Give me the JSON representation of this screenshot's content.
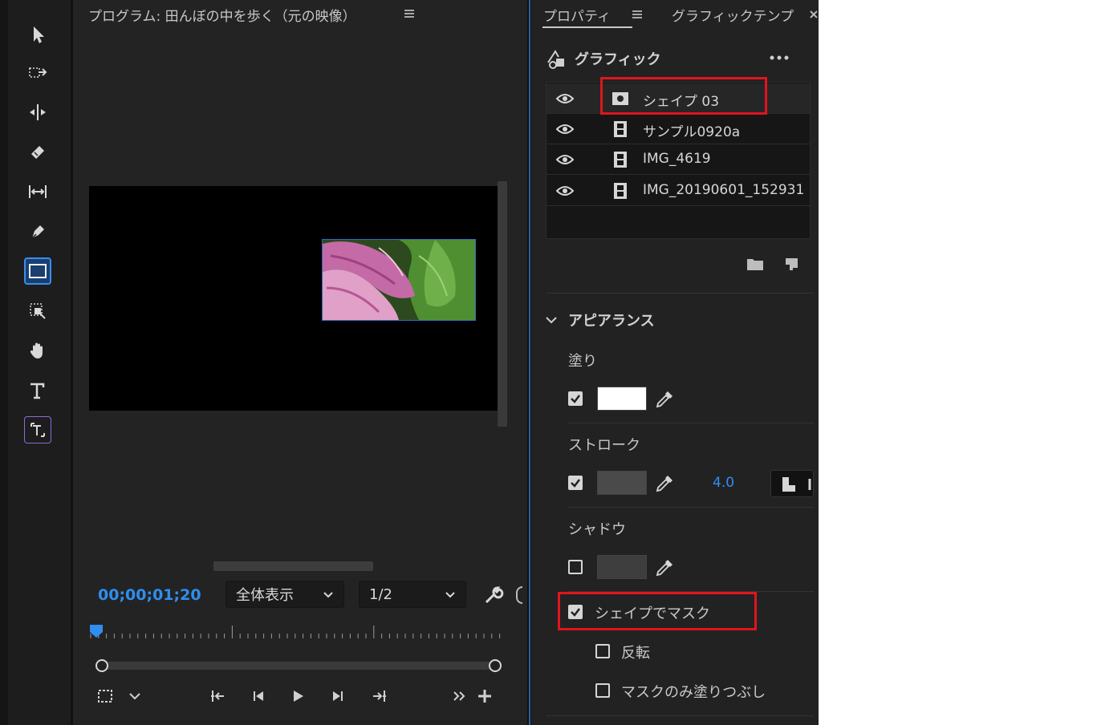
{
  "program": {
    "title": "プログラム: 田んぼの中を歩く（元の映像）",
    "menu_icon": "hamburger-menu-icon",
    "timecode": "00;00;01;20",
    "zoom": "全体表示",
    "resolution": "1/2"
  },
  "properties": {
    "tab_active": "プロパティ",
    "tab_other": "グラフィックテンプ",
    "graphic_title": "グラフィック",
    "layers": [
      {
        "name": "シェイプ 03",
        "type": "shape",
        "selected": true
      },
      {
        "name": "サンプル0920a",
        "type": "video"
      },
      {
        "name": "IMG_4619",
        "type": "video"
      },
      {
        "name": "IMG_20190601_152931",
        "type": "video"
      }
    ],
    "appearance_title": "アピアランス",
    "fill_label": "塗り",
    "stroke_label": "ストローク",
    "stroke_width": "4.0",
    "shadow_label": "シャドウ",
    "mask_label": "シェイプでマスク",
    "invert_label": "反転",
    "mask_only_label": "マスクのみ塗りつぶし",
    "fill_color": "#ffffff",
    "stroke_color": "#4a4a4a",
    "shadow_color": "#3e3e3e",
    "highlight_color": "#e0151d",
    "accent_color": "#2f8ef0"
  }
}
